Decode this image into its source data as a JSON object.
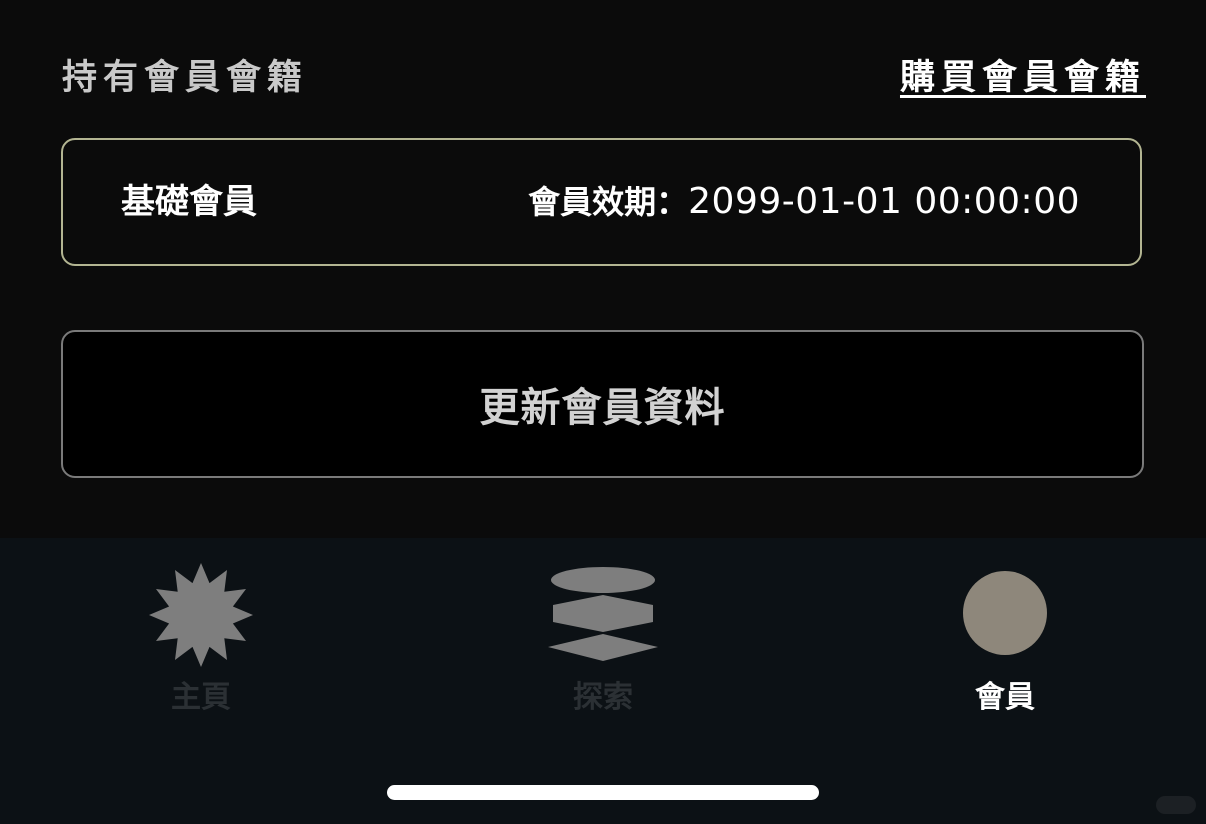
{
  "header": {
    "title": "持有會員會籍",
    "buy_link": "購買會員會籍"
  },
  "membership": {
    "tier": "基礎會員",
    "validity_label": "會員效期：",
    "validity_value": "2099-01-01 00:00:00"
  },
  "update_button": {
    "label": "更新會員資料"
  },
  "tab_bar": {
    "tabs": [
      {
        "label": "主頁",
        "icon": "starburst-icon",
        "active": false
      },
      {
        "label": "探索",
        "icon": "stack-icon",
        "active": false
      },
      {
        "label": "會員",
        "icon": "circle-icon",
        "active": true
      }
    ]
  },
  "colors": {
    "background": "#0b0b0b",
    "tab_bar_background": "#0c1115",
    "card_border": "#b3b592",
    "button_border": "#7a7a7a",
    "inactive_icon": "#7e7e7e",
    "active_icon": "#8e877b"
  }
}
